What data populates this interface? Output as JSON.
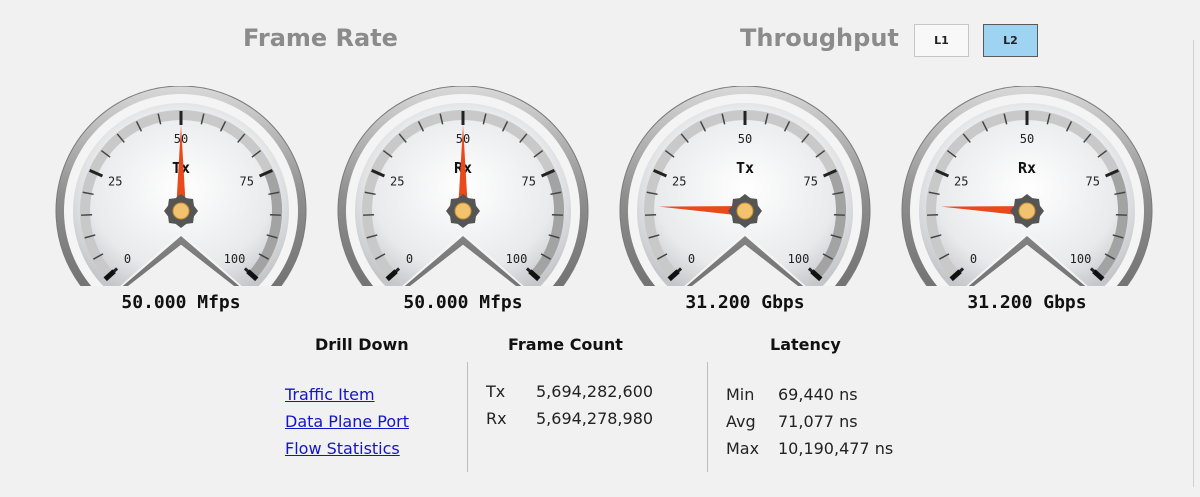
{
  "sections": {
    "frame_rate_title": "Frame Rate",
    "throughput_title": "Throughput"
  },
  "layer_toggle": {
    "l1_label": "L1",
    "l2_label": "L2",
    "active": "L2"
  },
  "gauges": [
    {
      "label": "Tx",
      "value_percent": 50,
      "display": "50.000 Mfps"
    },
    {
      "label": "Rx",
      "value_percent": 50,
      "display": "50.000 Mfps"
    },
    {
      "label": "Tx",
      "value_percent": 17,
      "display": "31.200 Gbps"
    },
    {
      "label": "Rx",
      "value_percent": 17,
      "display": "31.200 Gbps"
    }
  ],
  "gauge_scale": [
    "0",
    "25",
    "50",
    "75",
    "100"
  ],
  "gauge_colors": {
    "needle": "#e84a1c",
    "hub": "#555555",
    "hub_center": "#f2c36e"
  },
  "drill_down": {
    "title": "Drill Down",
    "links": [
      "Traffic Item",
      "Data Plane Port",
      "Flow Statistics"
    ]
  },
  "frame_count": {
    "title": "Frame Count",
    "rows": [
      {
        "label": "Tx",
        "value": "5,694,282,600"
      },
      {
        "label": "Rx",
        "value": "5,694,278,980"
      }
    ]
  },
  "latency": {
    "title": "Latency",
    "rows": [
      {
        "label": "Min",
        "value": "69,440 ns"
      },
      {
        "label": "Avg",
        "value": "71,077 ns"
      },
      {
        "label": "Max",
        "value": "10,190,477 ns"
      }
    ]
  }
}
